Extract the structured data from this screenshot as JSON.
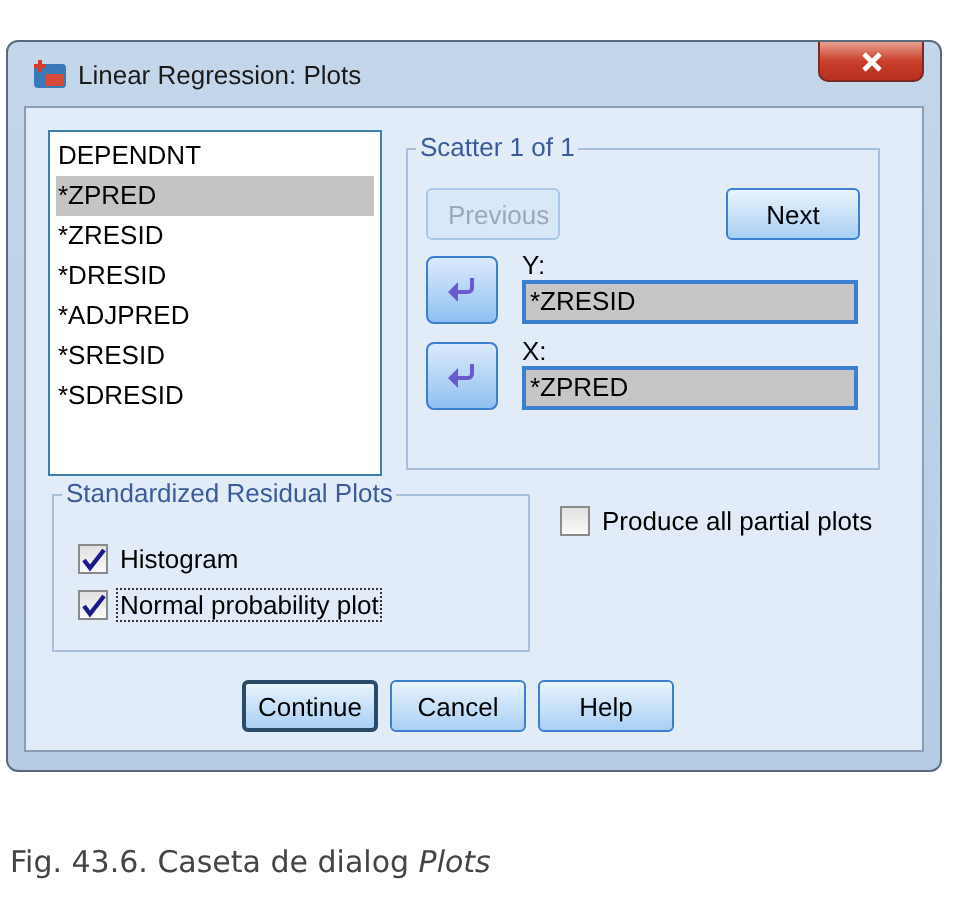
{
  "window": {
    "title": "Linear Regression: Plots"
  },
  "variables": [
    {
      "label": "DEPENDNT",
      "selected": false
    },
    {
      "label": "*ZPRED",
      "selected": true
    },
    {
      "label": "*ZRESID",
      "selected": false
    },
    {
      "label": "*DRESID",
      "selected": false
    },
    {
      "label": "*ADJPRED",
      "selected": false
    },
    {
      "label": "*SRESID",
      "selected": false
    },
    {
      "label": "*SDRESID",
      "selected": false
    }
  ],
  "scatter": {
    "title": "Scatter 1 of 1",
    "previous": {
      "label": "Previous",
      "disabled": true
    },
    "next": {
      "label": "Next",
      "disabled": false
    },
    "axes": [
      {
        "label": "Y:",
        "value": "*ZRESID"
      },
      {
        "label": "X:",
        "value": "*ZPRED"
      }
    ]
  },
  "residual_plots": {
    "title": "Standardized Residual Plots",
    "options": [
      {
        "label": "Histogram",
        "checked": true,
        "focused": false
      },
      {
        "label": "Normal probability plot",
        "checked": true,
        "focused": true
      }
    ]
  },
  "partial_plots": {
    "label": "Produce all partial plots",
    "checked": false
  },
  "buttons": [
    {
      "label": "Continue",
      "default": true
    },
    {
      "label": "Cancel",
      "default": false
    },
    {
      "label": "Help",
      "default": false
    }
  ],
  "caption": "Fig. 43.6. Caseta de dialog *Plots*"
}
